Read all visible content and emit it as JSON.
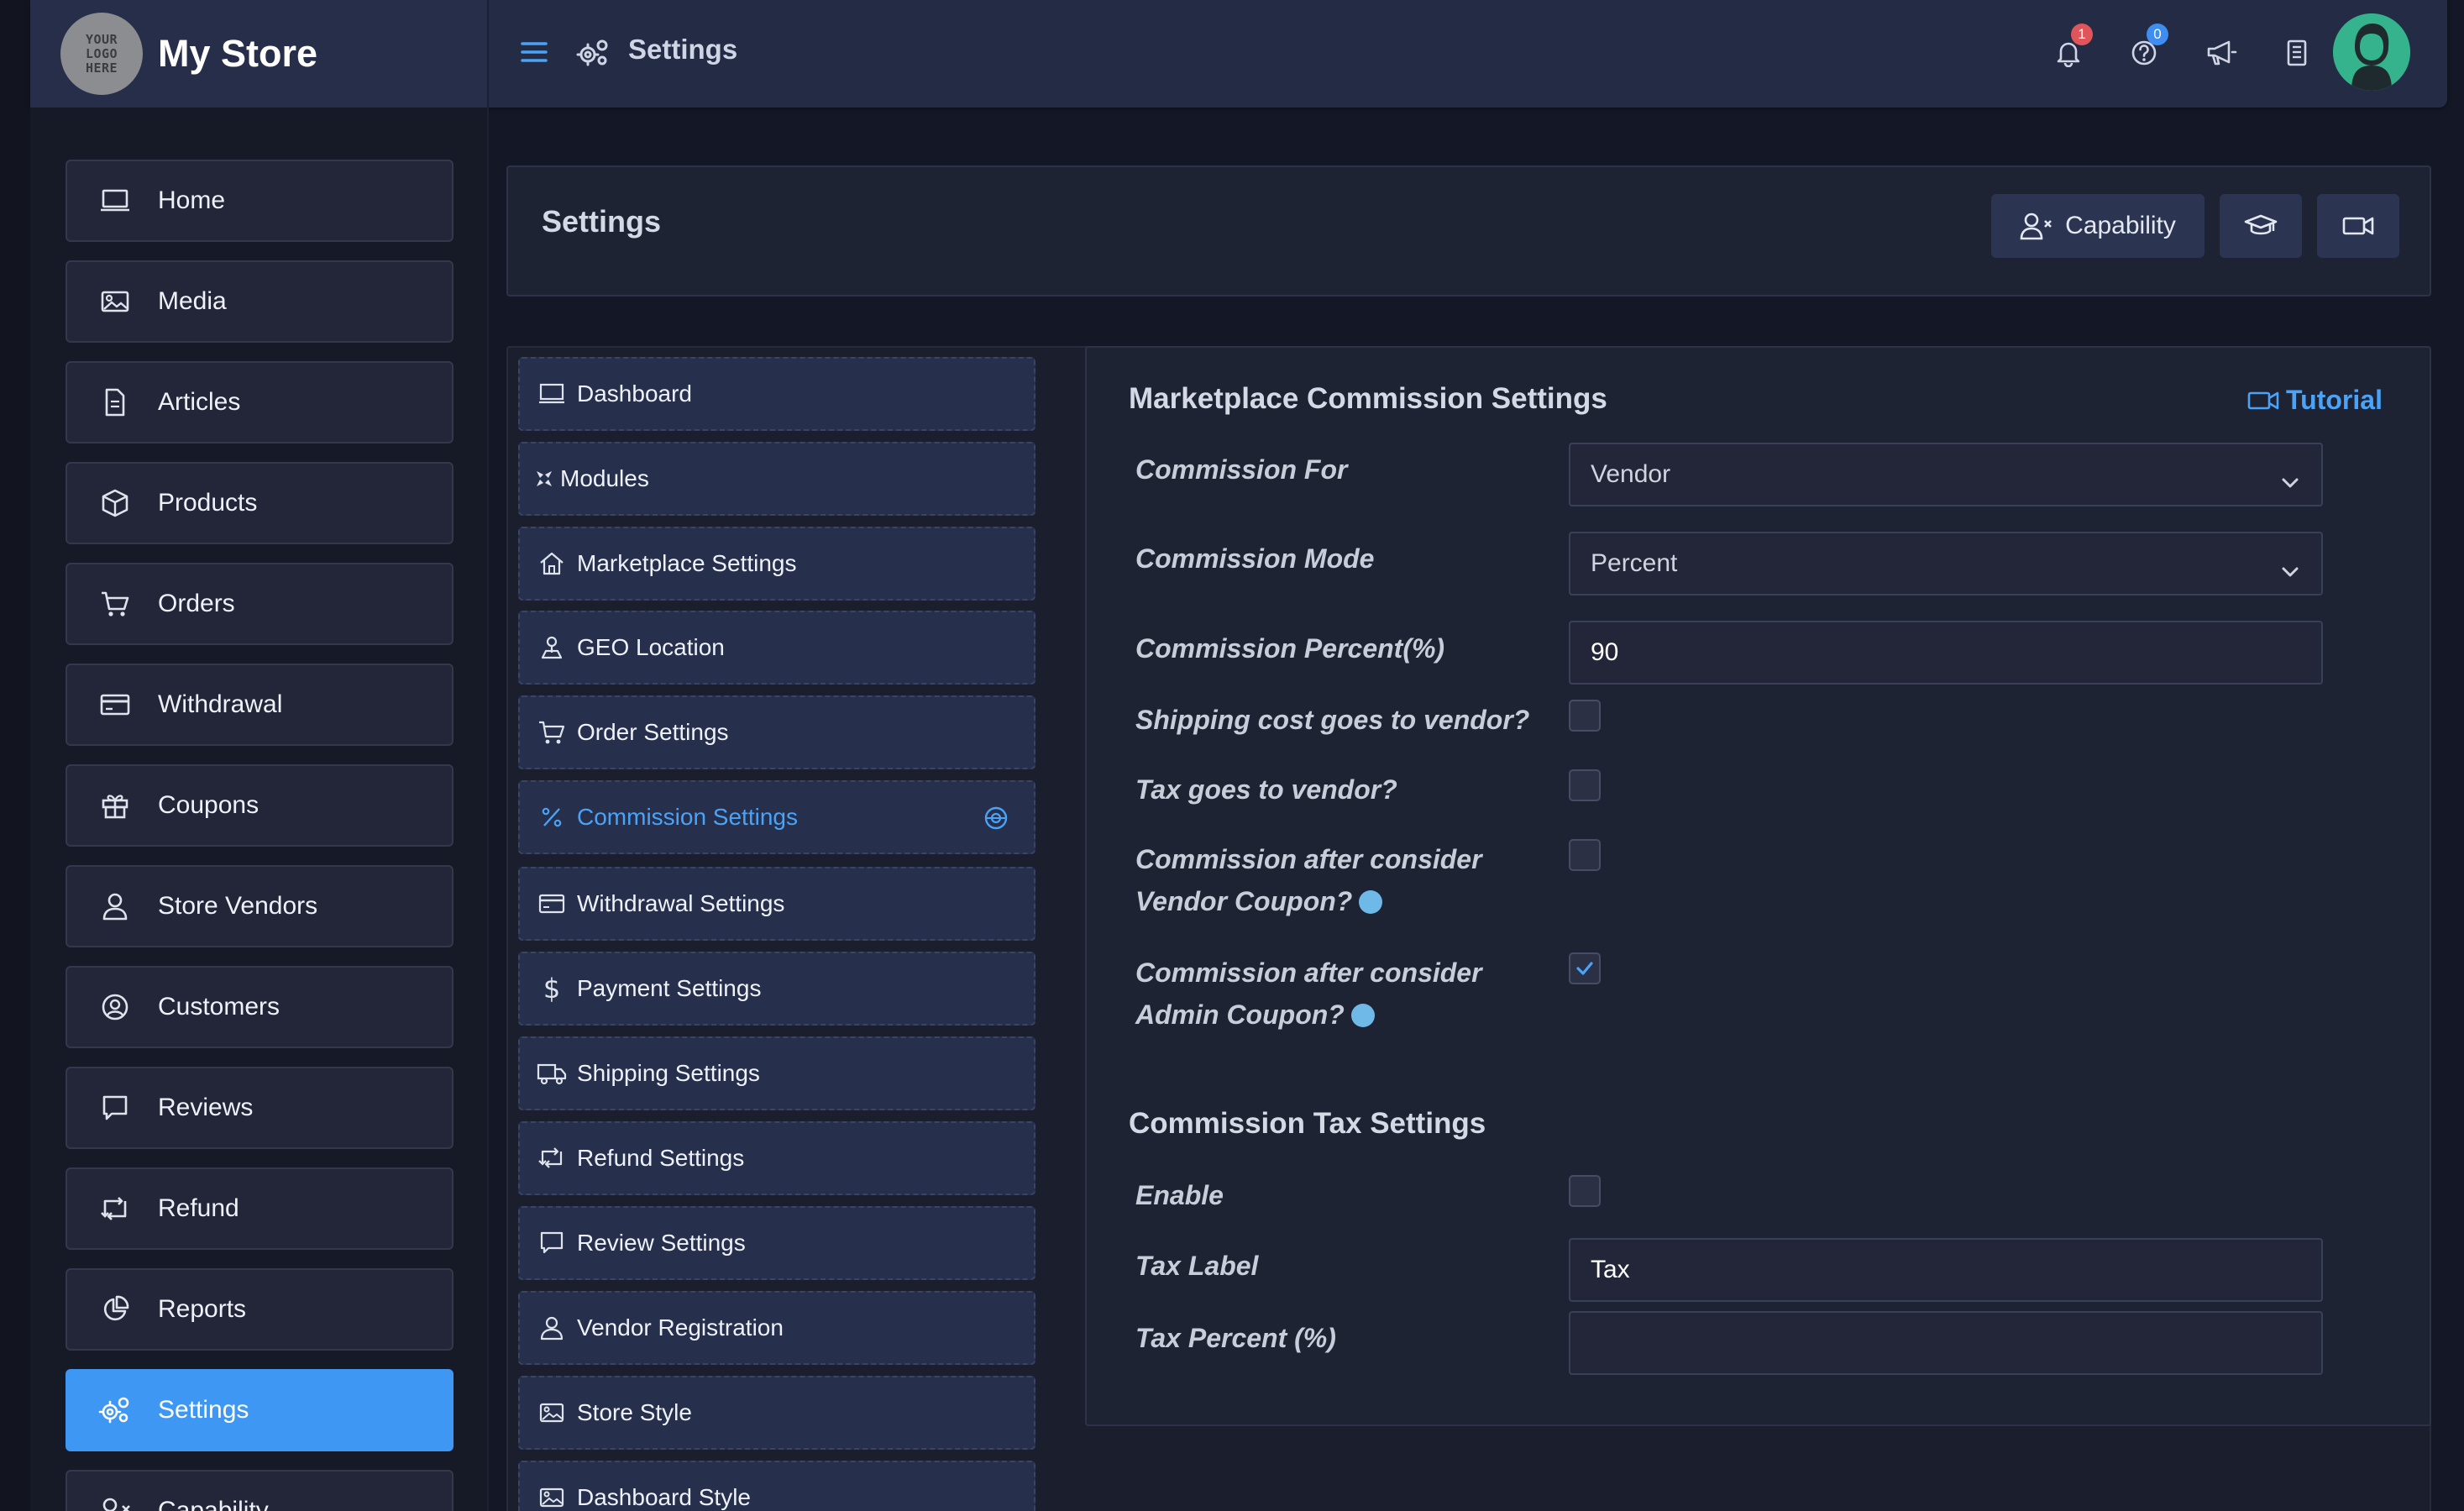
{
  "header": {
    "logo_lines": [
      "YOUR",
      "LOGO",
      "HERE"
    ],
    "brand_name": "My Store",
    "page_title": "Settings",
    "notifications_count": "1",
    "help_count": "0"
  },
  "nav": [
    {
      "label": "Home",
      "icon": "monitor-icon"
    },
    {
      "label": "Media",
      "icon": "image-icon"
    },
    {
      "label": "Articles",
      "icon": "document-icon"
    },
    {
      "label": "Products",
      "icon": "box-icon"
    },
    {
      "label": "Orders",
      "icon": "cart-icon"
    },
    {
      "label": "Withdrawal",
      "icon": "credit-card-icon"
    },
    {
      "label": "Coupons",
      "icon": "gift-icon"
    },
    {
      "label": "Store Vendors",
      "icon": "user-icon"
    },
    {
      "label": "Customers",
      "icon": "user-circle-icon"
    },
    {
      "label": "Reviews",
      "icon": "comment-icon"
    },
    {
      "label": "Refund",
      "icon": "retweet-icon"
    },
    {
      "label": "Reports",
      "icon": "pie-chart-icon"
    },
    {
      "label": "Settings",
      "icon": "gears-icon",
      "active": true
    },
    {
      "label": "Capability",
      "icon": "user-x-icon"
    }
  ],
  "settings_card": {
    "title": "Settings",
    "capability_label": "Capability"
  },
  "subnav": [
    {
      "label": "Dashboard",
      "icon": "monitor-icon"
    },
    {
      "label": "Modules",
      "icon": "modules-icon"
    },
    {
      "label": "Marketplace Settings",
      "icon": "home-icon"
    },
    {
      "label": "GEO Location",
      "icon": "location-icon"
    },
    {
      "label": "Order Settings",
      "icon": "cart-icon"
    },
    {
      "label": "Commission Settings",
      "icon": "percent-icon",
      "active": true
    },
    {
      "label": "Withdrawal Settings",
      "icon": "credit-card-icon"
    },
    {
      "label": "Payment Settings",
      "icon": "dollar-icon"
    },
    {
      "label": "Shipping Settings",
      "icon": "truck-icon"
    },
    {
      "label": "Refund Settings",
      "icon": "retweet-icon"
    },
    {
      "label": "Review Settings",
      "icon": "comment-icon"
    },
    {
      "label": "Vendor Registration",
      "icon": "user-icon"
    },
    {
      "label": "Store Style",
      "icon": "image-icon"
    },
    {
      "label": "Dashboard Style",
      "icon": "image-icon"
    }
  ],
  "commission": {
    "title": "Marketplace Commission Settings",
    "tutorial_label": "Tutorial",
    "commission_for_label": "Commission For",
    "commission_for_value": "Vendor",
    "commission_mode_label": "Commission Mode",
    "commission_mode_value": "Percent",
    "commission_percent_label": "Commission Percent(%)",
    "commission_percent_value": "90",
    "shipping_label": "Shipping cost goes to vendor?",
    "shipping_checked": false,
    "tax_vendor_label": "Tax goes to vendor?",
    "tax_vendor_checked": false,
    "vendor_coupon_label_1": "Commission after consider",
    "vendor_coupon_label_2": "Vendor Coupon?",
    "vendor_coupon_checked": false,
    "admin_coupon_label_1": "Commission after consider",
    "admin_coupon_label_2": "Admin Coupon?",
    "admin_coupon_checked": true
  },
  "tax": {
    "title": "Commission Tax Settings",
    "enable_label": "Enable",
    "enable_checked": false,
    "tax_label_label": "Tax Label",
    "tax_label_value": "Tax",
    "tax_percent_label": "Tax Percent (%)",
    "tax_percent_value": ""
  },
  "colors": {
    "accent": "#3e98f3",
    "link": "#4aa3f7",
    "header_bg": "#232b45",
    "page_bg": "#141826"
  }
}
